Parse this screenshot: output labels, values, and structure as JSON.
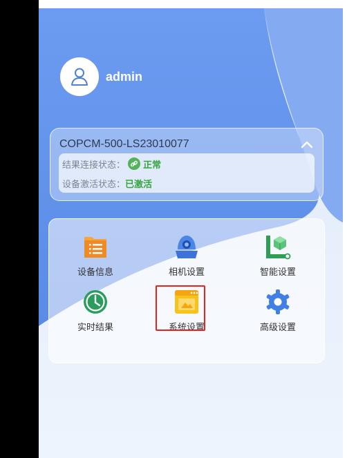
{
  "profile": {
    "username": "admin",
    "avatar_icon": "user-avatar-icon"
  },
  "device": {
    "title": "COPCM-500-LS23010077",
    "collapse_icon": "chevron-up-icon",
    "connection_label": "结果连接状态：",
    "connection_status": "正常",
    "connection_icon": "link-icon",
    "activation_label": "设备激活状态：",
    "activation_status": "已激活",
    "status_color": "#36a53d"
  },
  "menu": {
    "items": [
      {
        "label": "设备信息",
        "icon": "device-info-icon"
      },
      {
        "label": "相机设置",
        "icon": "camera-icon"
      },
      {
        "label": "智能设置",
        "icon": "smart-settings-icon"
      },
      {
        "label": "实时结果",
        "icon": "clock-icon"
      },
      {
        "label": "系统设置",
        "icon": "system-settings-icon"
      },
      {
        "label": "高级设置",
        "icon": "gear-icon"
      }
    ],
    "highlighted": "系统设置",
    "highlight_color": "#e8221b"
  },
  "colors": {
    "primary_blue": "#5b8ff0",
    "background": "#e9f0fb"
  }
}
